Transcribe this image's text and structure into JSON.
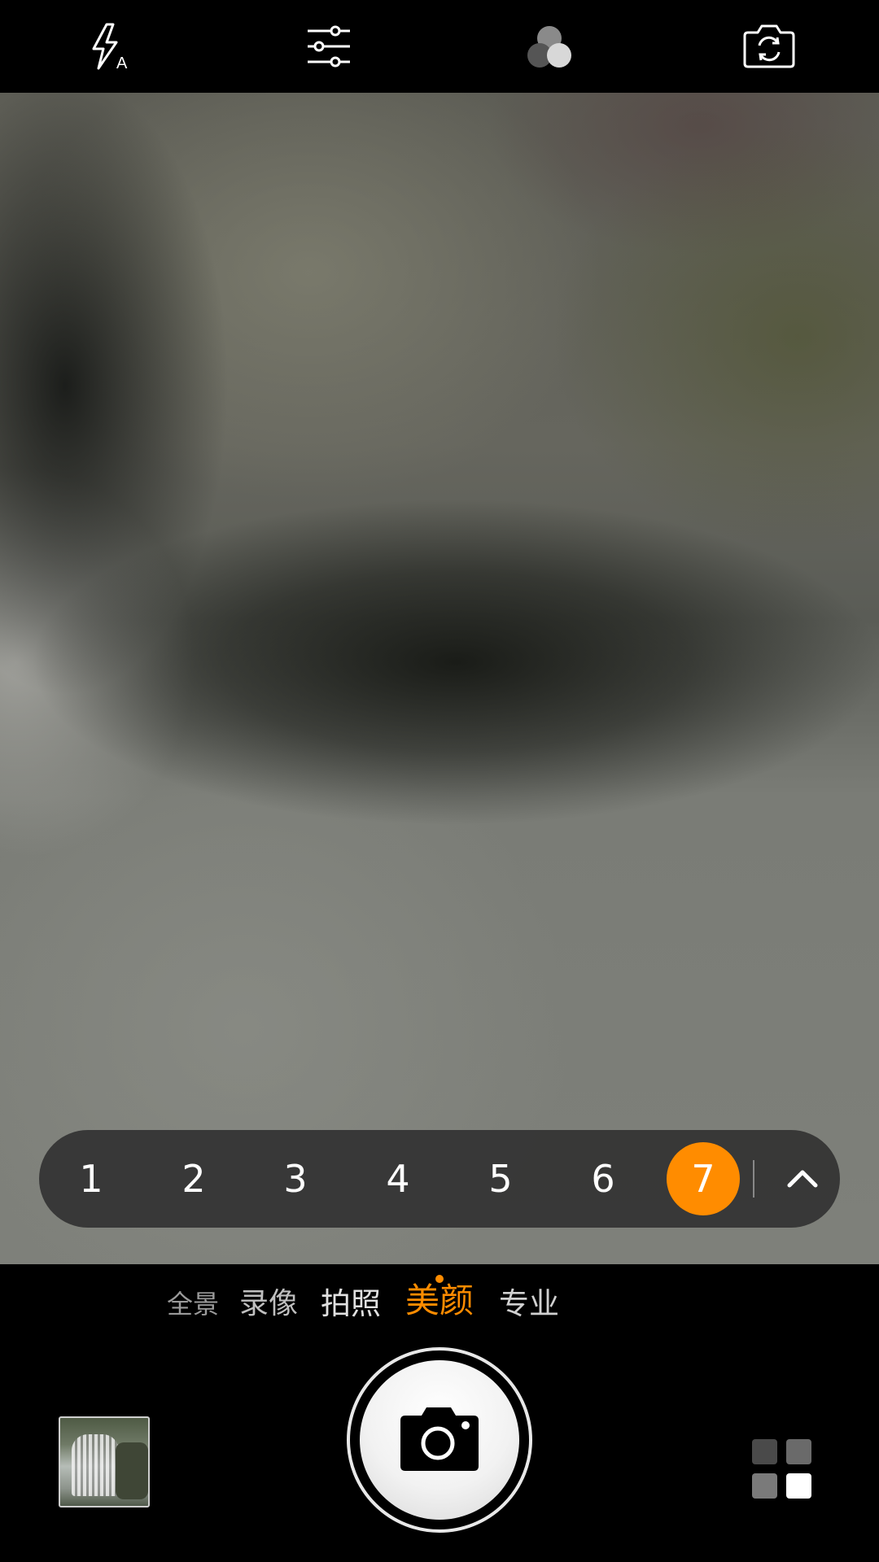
{
  "topbar": {
    "flash_icon": "flash-auto-icon",
    "flash_badge": "A",
    "settings_icon": "sliders-icon",
    "filter_icon": "filter-circles-icon",
    "switch_camera_icon": "camera-switch-icon"
  },
  "viewfinder": {
    "description_icon": "live-preview"
  },
  "beauty_levels": {
    "items": [
      "1",
      "2",
      "3",
      "4",
      "5",
      "6",
      "7"
    ],
    "selected": "7",
    "expand_icon": "chevron-up-icon"
  },
  "modes": {
    "items": [
      "全景",
      "录像",
      "拍照",
      "美颜",
      "专业"
    ],
    "selected": "美颜"
  },
  "bottom": {
    "gallery_icon": "gallery-thumbnail",
    "shutter_icon": "camera-icon",
    "more_icon": "grid-icon"
  },
  "colors": {
    "accent": "#ff8c00",
    "pill_bg": "#323232",
    "bar_bg": "#000000"
  }
}
